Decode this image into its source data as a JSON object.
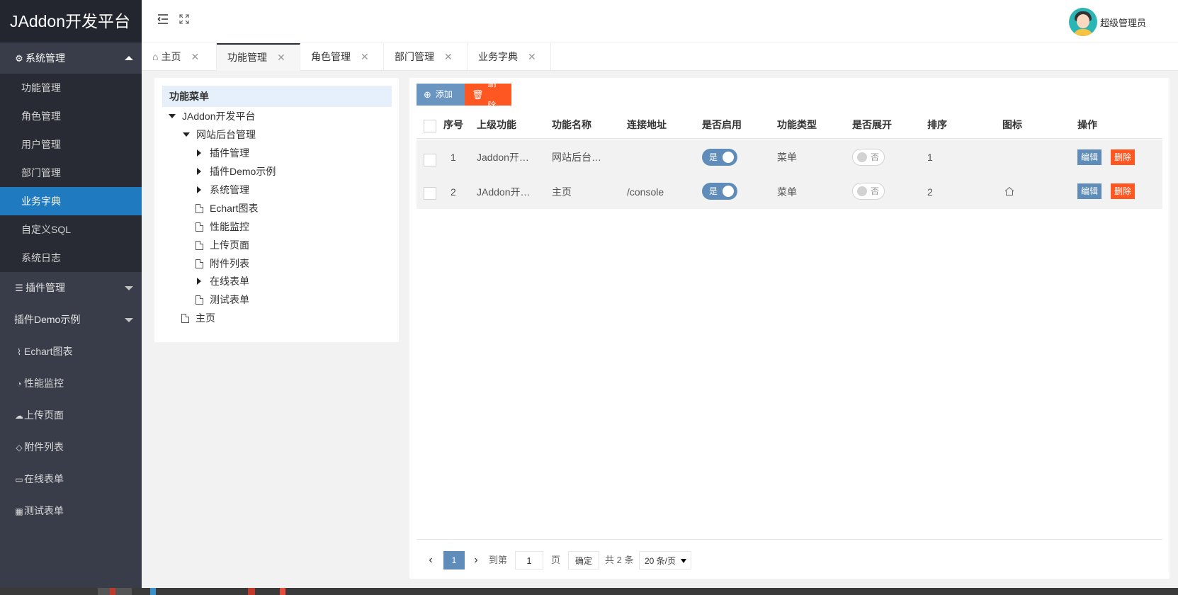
{
  "app": {
    "title": "JAddon开发平台"
  },
  "sidebar": {
    "groups": [
      {
        "label": "系统管理",
        "icon": "gear-icon",
        "expanded": true,
        "items": [
          "功能管理",
          "角色管理",
          "用户管理",
          "部门管理",
          "业务字典",
          "自定义SQL",
          "系统日志"
        ],
        "active": "业务字典"
      },
      {
        "label": "插件管理",
        "icon": "list-icon",
        "expanded": false
      },
      {
        "label": "插件Demo示例",
        "icon": "",
        "expanded": false
      }
    ],
    "items": [
      {
        "label": "Echart图表",
        "icon": "pulse-icon"
      },
      {
        "label": "性能监控",
        "icon": "gauge-icon"
      },
      {
        "label": "上传页面",
        "icon": "cloud-upload-icon"
      },
      {
        "label": "附件列表",
        "icon": "tag-icon"
      },
      {
        "label": "在线表单",
        "icon": "form-icon"
      },
      {
        "label": "测试表单",
        "icon": "grid-icon"
      }
    ]
  },
  "header": {
    "user_name": "超级管理员"
  },
  "tabs": [
    {
      "label": "主页",
      "icon": "home-icon"
    },
    {
      "label": "功能管理",
      "active": true
    },
    {
      "label": "角色管理"
    },
    {
      "label": "部门管理"
    },
    {
      "label": "业务字典"
    }
  ],
  "tree": {
    "title": "功能菜单",
    "nodes": [
      {
        "label": "JAddon开发平台",
        "type": "expanded"
      },
      {
        "label": "网站后台管理",
        "type": "expanded"
      },
      {
        "label": "插件管理",
        "type": "collapsed"
      },
      {
        "label": "插件Demo示例",
        "type": "collapsed"
      },
      {
        "label": "系统管理",
        "type": "collapsed"
      },
      {
        "label": "Echart图表",
        "type": "leaf"
      },
      {
        "label": "性能监控",
        "type": "leaf"
      },
      {
        "label": "上传页面",
        "type": "leaf"
      },
      {
        "label": "附件列表",
        "type": "leaf"
      },
      {
        "label": "在线表单",
        "type": "collapsed"
      },
      {
        "label": "测试表单",
        "type": "leaf"
      },
      {
        "label": "主页",
        "type": "leaf"
      }
    ]
  },
  "toolbar": {
    "add_label": "添加",
    "delete_label": "删除"
  },
  "table": {
    "columns": [
      "序号",
      "上级功能",
      "功能名称",
      "连接地址",
      "是否启用",
      "功能类型",
      "是否展开",
      "排序",
      "图标",
      "操作"
    ],
    "rows": [
      {
        "index": "1",
        "parent": "Jaddon开…",
        "name": "网站后台…",
        "url": "",
        "enabled": "是",
        "type": "菜单",
        "expand": "否",
        "sort": "1",
        "icon": "",
        "edit": "编辑",
        "delete": "删除"
      },
      {
        "index": "2",
        "parent": "JAddon开…",
        "name": "主页",
        "url": "/console",
        "enabled": "是",
        "type": "菜单",
        "expand": "否",
        "sort": "2",
        "icon": "home-icon",
        "edit": "编辑",
        "delete": "删除"
      }
    ]
  },
  "pager": {
    "current": "1",
    "goto_label": "到第",
    "goto_value": "1",
    "page_unit": "页",
    "confirm": "确定",
    "total": "共 2 条",
    "page_size": "20 条/页"
  },
  "colors": {
    "sidebar": "#393d49",
    "logo_bg": "#23262e",
    "active_nav": "#1f7ac0",
    "primary": "#5f8cb8",
    "danger": "#ff5722"
  }
}
